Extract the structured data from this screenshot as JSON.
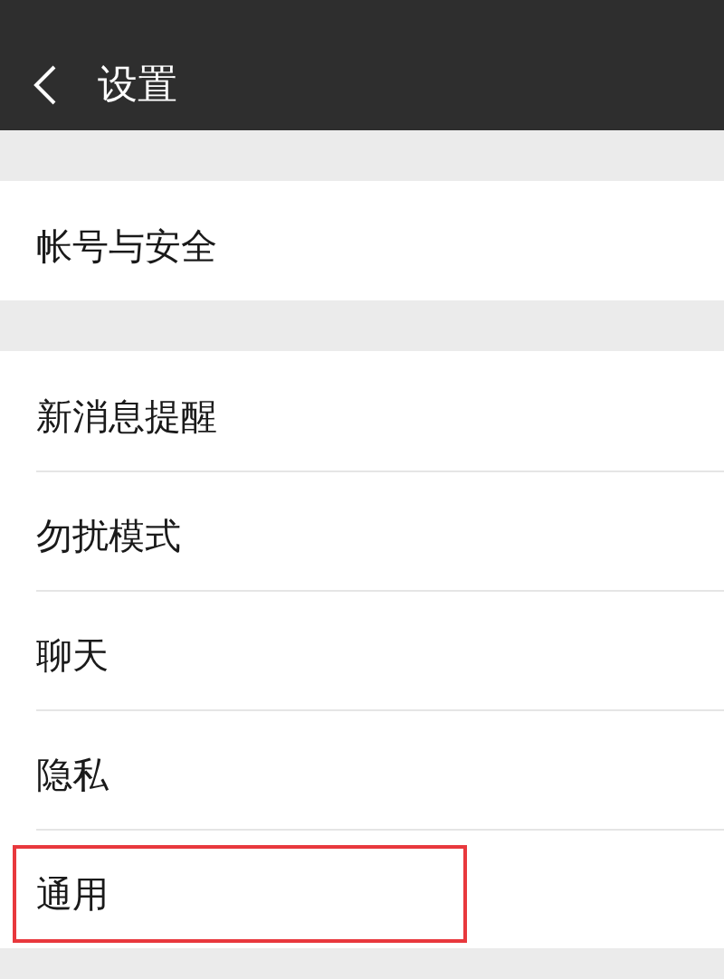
{
  "header": {
    "title": "设置"
  },
  "groups": [
    {
      "items": [
        {
          "label": "帐号与安全",
          "highlighted": false
        }
      ]
    },
    {
      "items": [
        {
          "label": "新消息提醒",
          "highlighted": false
        },
        {
          "label": "勿扰模式",
          "highlighted": false
        },
        {
          "label": "聊天",
          "highlighted": false
        },
        {
          "label": "隐私",
          "highlighted": false
        },
        {
          "label": "通用",
          "highlighted": true
        }
      ]
    }
  ]
}
